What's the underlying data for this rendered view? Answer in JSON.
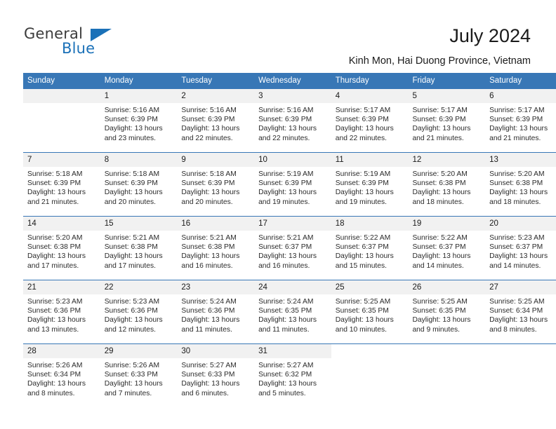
{
  "brand": {
    "name_part1": "General",
    "name_part2": "Blue",
    "accent_color": "#1b71b8"
  },
  "header": {
    "title": "July 2024",
    "subtitle": "Kinh Mon, Hai Duong Province, Vietnam"
  },
  "theme": {
    "header_row_bg": "#3877b6",
    "daynum_bg": "#f1f1f1",
    "grid_line": "#3877b6",
    "text": "#2b2b2b"
  },
  "weekday_headers": [
    "Sunday",
    "Monday",
    "Tuesday",
    "Wednesday",
    "Thursday",
    "Friday",
    "Saturday"
  ],
  "labels": {
    "sunrise_prefix": "Sunrise:",
    "sunset_prefix": "Sunset:",
    "daylight_prefix": "Daylight:"
  },
  "weeks": [
    [
      {
        "day": "",
        "sunrise": "",
        "sunset": "",
        "daylight_line1": "",
        "daylight_line2": "",
        "empty": true
      },
      {
        "day": "1",
        "sunrise": "Sunrise: 5:16 AM",
        "sunset": "Sunset: 6:39 PM",
        "daylight_line1": "Daylight: 13 hours",
        "daylight_line2": "and 23 minutes."
      },
      {
        "day": "2",
        "sunrise": "Sunrise: 5:16 AM",
        "sunset": "Sunset: 6:39 PM",
        "daylight_line1": "Daylight: 13 hours",
        "daylight_line2": "and 22 minutes."
      },
      {
        "day": "3",
        "sunrise": "Sunrise: 5:16 AM",
        "sunset": "Sunset: 6:39 PM",
        "daylight_line1": "Daylight: 13 hours",
        "daylight_line2": "and 22 minutes."
      },
      {
        "day": "4",
        "sunrise": "Sunrise: 5:17 AM",
        "sunset": "Sunset: 6:39 PM",
        "daylight_line1": "Daylight: 13 hours",
        "daylight_line2": "and 22 minutes."
      },
      {
        "day": "5",
        "sunrise": "Sunrise: 5:17 AM",
        "sunset": "Sunset: 6:39 PM",
        "daylight_line1": "Daylight: 13 hours",
        "daylight_line2": "and 21 minutes."
      },
      {
        "day": "6",
        "sunrise": "Sunrise: 5:17 AM",
        "sunset": "Sunset: 6:39 PM",
        "daylight_line1": "Daylight: 13 hours",
        "daylight_line2": "and 21 minutes."
      }
    ],
    [
      {
        "day": "7",
        "sunrise": "Sunrise: 5:18 AM",
        "sunset": "Sunset: 6:39 PM",
        "daylight_line1": "Daylight: 13 hours",
        "daylight_line2": "and 21 minutes."
      },
      {
        "day": "8",
        "sunrise": "Sunrise: 5:18 AM",
        "sunset": "Sunset: 6:39 PM",
        "daylight_line1": "Daylight: 13 hours",
        "daylight_line2": "and 20 minutes."
      },
      {
        "day": "9",
        "sunrise": "Sunrise: 5:18 AM",
        "sunset": "Sunset: 6:39 PM",
        "daylight_line1": "Daylight: 13 hours",
        "daylight_line2": "and 20 minutes."
      },
      {
        "day": "10",
        "sunrise": "Sunrise: 5:19 AM",
        "sunset": "Sunset: 6:39 PM",
        "daylight_line1": "Daylight: 13 hours",
        "daylight_line2": "and 19 minutes."
      },
      {
        "day": "11",
        "sunrise": "Sunrise: 5:19 AM",
        "sunset": "Sunset: 6:39 PM",
        "daylight_line1": "Daylight: 13 hours",
        "daylight_line2": "and 19 minutes."
      },
      {
        "day": "12",
        "sunrise": "Sunrise: 5:20 AM",
        "sunset": "Sunset: 6:38 PM",
        "daylight_line1": "Daylight: 13 hours",
        "daylight_line2": "and 18 minutes."
      },
      {
        "day": "13",
        "sunrise": "Sunrise: 5:20 AM",
        "sunset": "Sunset: 6:38 PM",
        "daylight_line1": "Daylight: 13 hours",
        "daylight_line2": "and 18 minutes."
      }
    ],
    [
      {
        "day": "14",
        "sunrise": "Sunrise: 5:20 AM",
        "sunset": "Sunset: 6:38 PM",
        "daylight_line1": "Daylight: 13 hours",
        "daylight_line2": "and 17 minutes."
      },
      {
        "day": "15",
        "sunrise": "Sunrise: 5:21 AM",
        "sunset": "Sunset: 6:38 PM",
        "daylight_line1": "Daylight: 13 hours",
        "daylight_line2": "and 17 minutes."
      },
      {
        "day": "16",
        "sunrise": "Sunrise: 5:21 AM",
        "sunset": "Sunset: 6:38 PM",
        "daylight_line1": "Daylight: 13 hours",
        "daylight_line2": "and 16 minutes."
      },
      {
        "day": "17",
        "sunrise": "Sunrise: 5:21 AM",
        "sunset": "Sunset: 6:37 PM",
        "daylight_line1": "Daylight: 13 hours",
        "daylight_line2": "and 16 minutes."
      },
      {
        "day": "18",
        "sunrise": "Sunrise: 5:22 AM",
        "sunset": "Sunset: 6:37 PM",
        "daylight_line1": "Daylight: 13 hours",
        "daylight_line2": "and 15 minutes."
      },
      {
        "day": "19",
        "sunrise": "Sunrise: 5:22 AM",
        "sunset": "Sunset: 6:37 PM",
        "daylight_line1": "Daylight: 13 hours",
        "daylight_line2": "and 14 minutes."
      },
      {
        "day": "20",
        "sunrise": "Sunrise: 5:23 AM",
        "sunset": "Sunset: 6:37 PM",
        "daylight_line1": "Daylight: 13 hours",
        "daylight_line2": "and 14 minutes."
      }
    ],
    [
      {
        "day": "21",
        "sunrise": "Sunrise: 5:23 AM",
        "sunset": "Sunset: 6:36 PM",
        "daylight_line1": "Daylight: 13 hours",
        "daylight_line2": "and 13 minutes."
      },
      {
        "day": "22",
        "sunrise": "Sunrise: 5:23 AM",
        "sunset": "Sunset: 6:36 PM",
        "daylight_line1": "Daylight: 13 hours",
        "daylight_line2": "and 12 minutes."
      },
      {
        "day": "23",
        "sunrise": "Sunrise: 5:24 AM",
        "sunset": "Sunset: 6:36 PM",
        "daylight_line1": "Daylight: 13 hours",
        "daylight_line2": "and 11 minutes."
      },
      {
        "day": "24",
        "sunrise": "Sunrise: 5:24 AM",
        "sunset": "Sunset: 6:35 PM",
        "daylight_line1": "Daylight: 13 hours",
        "daylight_line2": "and 11 minutes."
      },
      {
        "day": "25",
        "sunrise": "Sunrise: 5:25 AM",
        "sunset": "Sunset: 6:35 PM",
        "daylight_line1": "Daylight: 13 hours",
        "daylight_line2": "and 10 minutes."
      },
      {
        "day": "26",
        "sunrise": "Sunrise: 5:25 AM",
        "sunset": "Sunset: 6:35 PM",
        "daylight_line1": "Daylight: 13 hours",
        "daylight_line2": "and 9 minutes."
      },
      {
        "day": "27",
        "sunrise": "Sunrise: 5:25 AM",
        "sunset": "Sunset: 6:34 PM",
        "daylight_line1": "Daylight: 13 hours",
        "daylight_line2": "and 8 minutes."
      }
    ],
    [
      {
        "day": "28",
        "sunrise": "Sunrise: 5:26 AM",
        "sunset": "Sunset: 6:34 PM",
        "daylight_line1": "Daylight: 13 hours",
        "daylight_line2": "and 8 minutes."
      },
      {
        "day": "29",
        "sunrise": "Sunrise: 5:26 AM",
        "sunset": "Sunset: 6:33 PM",
        "daylight_line1": "Daylight: 13 hours",
        "daylight_line2": "and 7 minutes."
      },
      {
        "day": "30",
        "sunrise": "Sunrise: 5:27 AM",
        "sunset": "Sunset: 6:33 PM",
        "daylight_line1": "Daylight: 13 hours",
        "daylight_line2": "and 6 minutes."
      },
      {
        "day": "31",
        "sunrise": "Sunrise: 5:27 AM",
        "sunset": "Sunset: 6:32 PM",
        "daylight_line1": "Daylight: 13 hours",
        "daylight_line2": "and 5 minutes."
      },
      {
        "day": "",
        "sunrise": "",
        "sunset": "",
        "daylight_line1": "",
        "daylight_line2": "",
        "empty": true,
        "trailing": true
      },
      {
        "day": "",
        "sunrise": "",
        "sunset": "",
        "daylight_line1": "",
        "daylight_line2": "",
        "empty": true,
        "trailing": true
      },
      {
        "day": "",
        "sunrise": "",
        "sunset": "",
        "daylight_line1": "",
        "daylight_line2": "",
        "empty": true,
        "trailing": true
      }
    ]
  ]
}
